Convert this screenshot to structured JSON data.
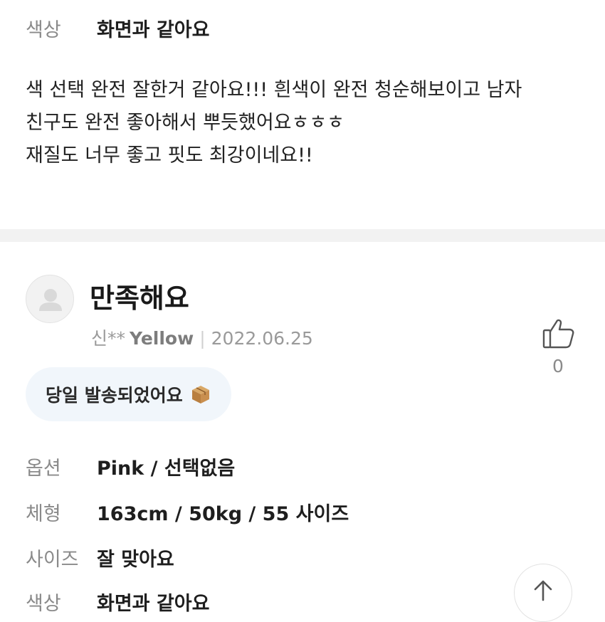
{
  "top_row": {
    "label": "색상",
    "value": "화면과 같아요"
  },
  "review_body": {
    "lines": [
      "색 선택 완전 잘한거 같아요!!! 흰색이 완전 청순해보이고 남자",
      "친구도 완전 좋아해서 뿌듯했어요ㅎㅎㅎ",
      "재질도 너무 좋고 핏도 최강이네요!!"
    ]
  },
  "review": {
    "title": "만족해요",
    "user": "신**",
    "option_color": "Yellow",
    "date": "2022.06.25",
    "like_count": "0",
    "tag": "당일 발송되었어요",
    "details": [
      {
        "label": "옵션",
        "value": "Pink / 선택없음"
      },
      {
        "label": "체형",
        "value": "163cm / 50kg / 55 사이즈"
      },
      {
        "label": "사이즈",
        "value": "잘 맞아요"
      },
      {
        "label": "색상",
        "value": "화면과 같아요"
      }
    ]
  },
  "icons": {
    "avatar": "user-avatar-icon",
    "like": "thumbs-up-icon",
    "tag": "package-box-icon",
    "scroll": "arrow-up-icon"
  }
}
